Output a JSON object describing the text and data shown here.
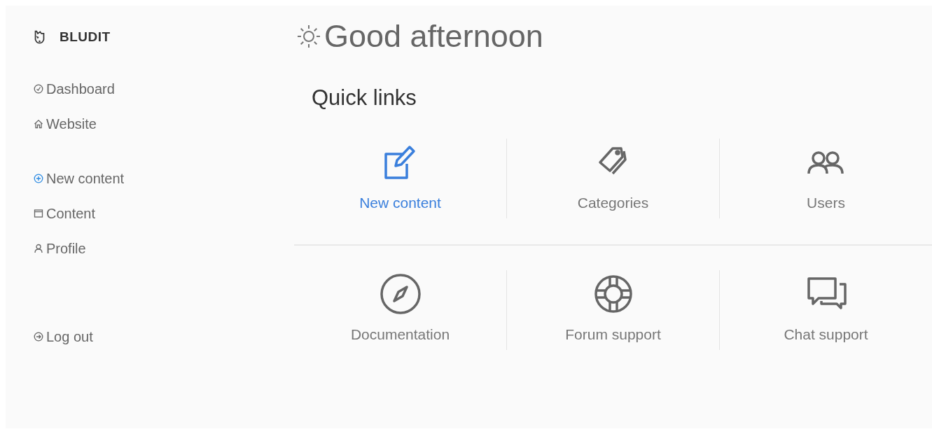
{
  "brand": {
    "name": "BLUDIT"
  },
  "sidebar": {
    "groups": [
      [
        {
          "label": "Dashboard",
          "kind": "dashboard"
        },
        {
          "label": "Website",
          "kind": "website"
        }
      ],
      [
        {
          "label": "New content",
          "kind": "new"
        },
        {
          "label": "Content",
          "kind": "content"
        },
        {
          "label": "Profile",
          "kind": "profile"
        }
      ],
      [
        {
          "label": "Log out",
          "kind": "logout"
        }
      ]
    ]
  },
  "greeting": {
    "text": "Good afternoon"
  },
  "quick_links": {
    "title": "Quick links",
    "rows": [
      [
        {
          "label": "New content",
          "kind": "edit",
          "selected": true
        },
        {
          "label": "Categories",
          "kind": "tags",
          "selected": false
        },
        {
          "label": "Users",
          "kind": "users",
          "selected": false
        }
      ],
      [
        {
          "label": "Documentation",
          "kind": "compass",
          "selected": false
        },
        {
          "label": "Forum support",
          "kind": "lifebuoy",
          "selected": false
        },
        {
          "label": "Chat support",
          "kind": "chat",
          "selected": false
        }
      ]
    ]
  }
}
